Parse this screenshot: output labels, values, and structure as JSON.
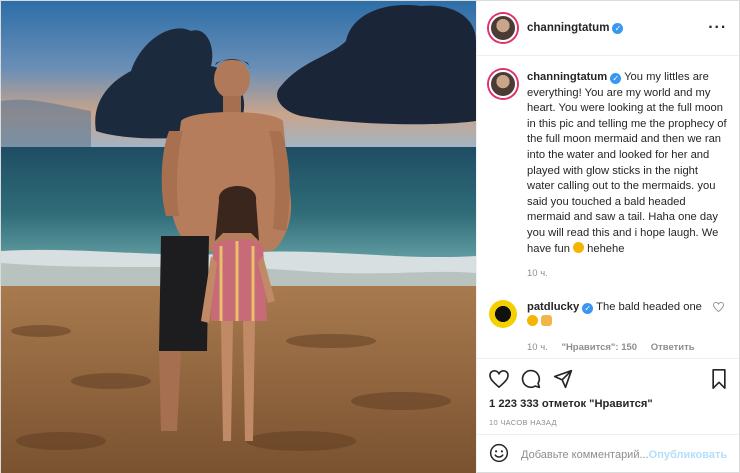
{
  "post": {
    "author": "channingtatum",
    "caption_author": "channingtatum",
    "caption": "You my littles are everything! You are my world and my heart. You were looking at the full moon in this pic and telling me the prophecy of the full moon mermaid and then we ran into the water and looked for her and played with glow sticks in the night water calling out to the mermaids. you said you touched a bald headed mermaid and saw a tail. Haha one day you will read this and i hope laugh. We have fun",
    "caption_tail": "hehehe",
    "caption_time": "10 ч.",
    "likes_count": "1 223 333",
    "likes_text": "отметок \"Нравится\"",
    "time_ago": "10 ЧАСОВ НАЗАД"
  },
  "comments": [
    {
      "author": "patdlucky",
      "text": "The bald headed one",
      "time": "10 ч.",
      "likes": "\"Нравится\": 150",
      "reply": "Ответить"
    }
  ],
  "comment_box": {
    "placeholder": "Добавьте комментарий...",
    "publish": "Опубликовать"
  },
  "icons": {
    "more": "more-options-icon",
    "verified": "verified-badge-icon",
    "like": "heart-icon",
    "comment": "comment-icon",
    "share": "share-icon",
    "save": "bookmark-icon",
    "emoji": "emoji-icon"
  },
  "colors": {
    "verified": "#3897f0",
    "publish": "#b2dffc",
    "story_ring": "#e1306c"
  }
}
